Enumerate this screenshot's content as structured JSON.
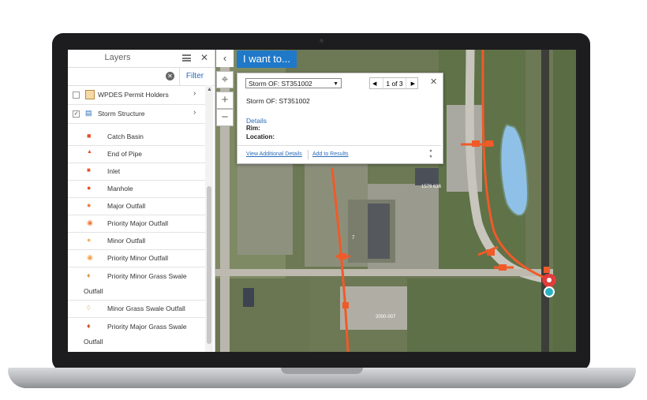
{
  "layers_panel": {
    "title": "Layers",
    "search_placeholder": "",
    "filter_label": "Filter",
    "layers": [
      {
        "label": "WPDES Permit Holders",
        "checked": false
      },
      {
        "label": "Storm Structure",
        "checked": true
      }
    ],
    "legend": [
      {
        "label": "Catch Basin",
        "symbol": "square-red"
      },
      {
        "label": "End of Pipe",
        "symbol": "triangle-red"
      },
      {
        "label": "Inlet",
        "symbol": "square-red"
      },
      {
        "label": "Manhole",
        "symbol": "circle-red"
      },
      {
        "label": "Major Outfall",
        "symbol": "circle-orange"
      },
      {
        "label": "Priority Major Outfall",
        "symbol": "circle-orange-dot"
      },
      {
        "label": "Minor Outfall",
        "symbol": "circle-light-orange"
      },
      {
        "label": "Priority Minor Outfall",
        "symbol": "circle-light-orange-dot"
      },
      {
        "label": "Priority Minor Grass Swale",
        "label2": "Outfall",
        "symbol": "diamond-orange"
      },
      {
        "label": "Minor Grass Swale Outfall",
        "symbol": "diamond-light"
      },
      {
        "label": "Priority Major Grass Swale",
        "label2": "Outfall",
        "symbol": "diamond-red"
      }
    ]
  },
  "toolbar": {
    "i_want_to": "I want to...",
    "collapse_icon": "chevron-left-icon",
    "locate_icon": "crosshair-icon",
    "zoom_in": "+",
    "zoom_out": "−"
  },
  "popup": {
    "selected_feature": "Storm OF: ST351002",
    "pager": "1 of 3",
    "title": "Storm OF: ST351002",
    "details_label": "Details",
    "fields": [
      "Rim:",
      "Location:"
    ],
    "view_additional_details": "View Additional Details",
    "add_to_results": "Add to Results"
  },
  "map_labels": [
    "7",
    "1579 636",
    "2000-007"
  ],
  "colors": {
    "accent": "#1f78c8",
    "storm_line": "#f05a28",
    "link": "#2a6bb8"
  }
}
